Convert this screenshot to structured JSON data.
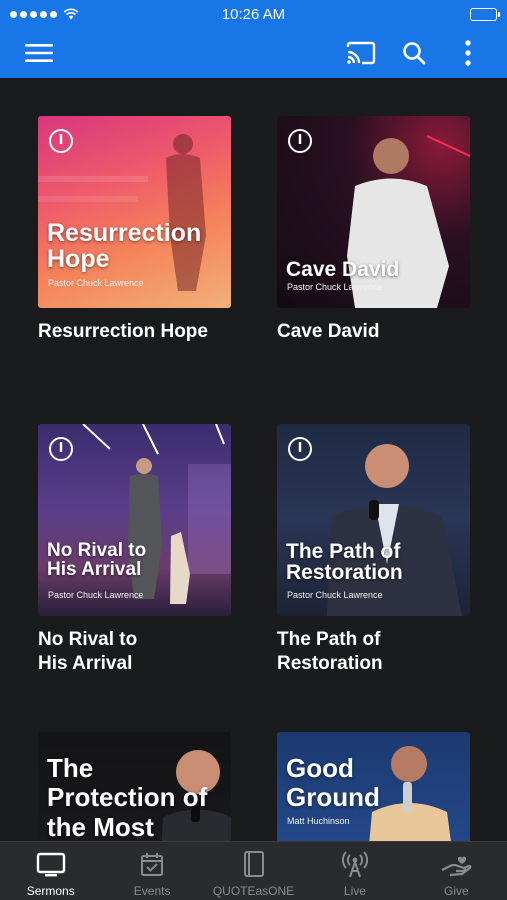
{
  "status_bar": {
    "time": "10:26 AM"
  },
  "grid": {
    "cards": [
      {
        "thumb_title": "Resurrection Hope",
        "thumb_speaker": "Pastor Chuck Lawrence",
        "caption": "Resurrection Hope"
      },
      {
        "thumb_title": "Cave David",
        "thumb_speaker": "Pastor Chuck Lawrence",
        "caption": "Cave David"
      },
      {
        "thumb_title": "No Rival to His Arrival",
        "thumb_speaker": "Pastor Chuck Lawrence",
        "caption": "No Rival to His Arrival"
      },
      {
        "thumb_title": "The Path of Restoration",
        "thumb_speaker": "Pastor Chuck Lawrence",
        "caption": "The Path of Restoration"
      },
      {
        "thumb_title": "The Protection of the Most"
      },
      {
        "thumb_title": "Good Ground",
        "thumb_speaker": "Matt Huchinson"
      }
    ]
  },
  "tab_bar": {
    "tabs": [
      {
        "label": "Sermons",
        "icon": "tv-icon",
        "active": true
      },
      {
        "label": "Events",
        "icon": "calendar-check-icon"
      },
      {
        "label": "QUOTEasONE",
        "icon": "tablet-icon"
      },
      {
        "label": "Live",
        "icon": "broadcast-antenna-icon"
      },
      {
        "label": "Give",
        "icon": "giving-hand-icon"
      }
    ]
  },
  "colors": {
    "app_bar": "#1976e6",
    "background": "#1a1b1d",
    "tab_bar": "#2a2b2d",
    "tab_active": "#ffffff",
    "tab_inactive": "#8a8b8e"
  }
}
